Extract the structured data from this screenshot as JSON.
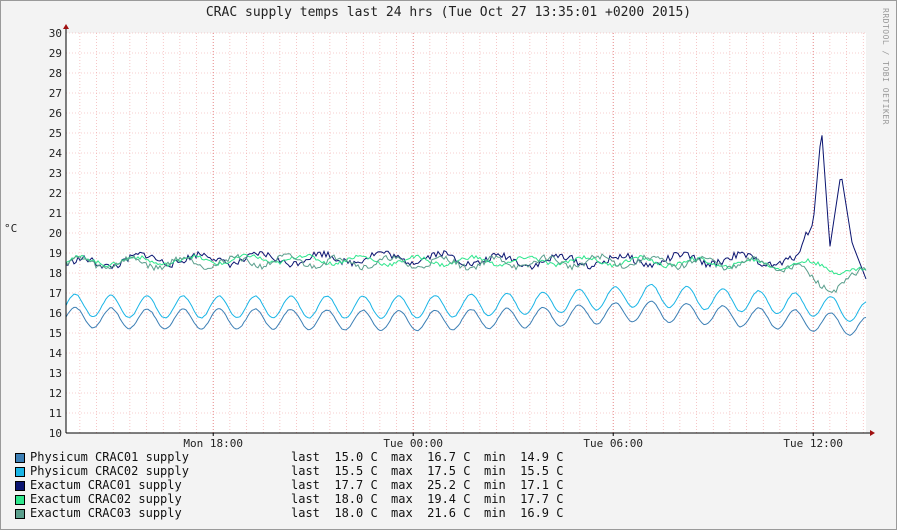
{
  "watermark": "RRDTOOL / TOBI OETIKER",
  "chart_data": {
    "type": "line",
    "title": "CRAC supply temps last 24 hrs (Tue Oct 27 13:35:01 +0200 2015)",
    "ylabel": "°C",
    "xlabel": "",
    "ylim": [
      10,
      30
    ],
    "yticks": [
      10,
      11,
      12,
      13,
      14,
      15,
      16,
      17,
      18,
      19,
      20,
      21,
      22,
      23,
      24,
      25,
      26,
      27,
      28,
      29,
      30
    ],
    "xlim": [
      "2015-10-26 13:35",
      "2015-10-27 13:35"
    ],
    "xticks": [
      {
        "label": "Mon 18:00",
        "time": "2015-10-26 18:00"
      },
      {
        "label": "Tue 00:00",
        "time": "2015-10-27 00:00"
      },
      {
        "label": "Tue 06:00",
        "time": "2015-10-27 06:00"
      },
      {
        "label": "Tue 12:00",
        "time": "2015-10-27 12:00"
      }
    ],
    "grid": true,
    "legend_position": "bottom",
    "series": [
      {
        "name": "Physicum CRAC01 supply",
        "color": "#3c7fb5",
        "last": "15.0 C",
        "max": "16.7 C",
        "min": "14.9 C",
        "points": [
          [
            "2015-10-26 13:35",
            15.8
          ],
          [
            "2015-10-26 16:00",
            15.7
          ],
          [
            "2015-10-26 20:00",
            15.7
          ],
          [
            "2015-10-27 00:00",
            15.6
          ],
          [
            "2015-10-27 04:00",
            15.8
          ],
          [
            "2015-10-27 07:00",
            16.1
          ],
          [
            "2015-10-27 10:00",
            15.8
          ],
          [
            "2015-10-27 12:00",
            15.6
          ],
          [
            "2015-10-27 13:35",
            15.3
          ]
        ]
      },
      {
        "name": "Physicum CRAC02 supply",
        "color": "#1ab5e6",
        "last": "15.5 C",
        "max": "17.5 C",
        "min": "15.5 C",
        "points": [
          [
            "2015-10-26 13:35",
            16.4
          ],
          [
            "2015-10-26 16:00",
            16.3
          ],
          [
            "2015-10-26 20:00",
            16.3
          ],
          [
            "2015-10-27 00:00",
            16.3
          ],
          [
            "2015-10-27 04:00",
            16.5
          ],
          [
            "2015-10-27 07:00",
            16.9
          ],
          [
            "2015-10-27 10:00",
            16.6
          ],
          [
            "2015-10-27 12:00",
            16.4
          ],
          [
            "2015-10-27 13:35",
            16.0
          ]
        ]
      },
      {
        "name": "Exactum CRAC01 supply",
        "color": "#0a1470",
        "last": "17.7 C",
        "max": "25.2 C",
        "min": "17.1 C",
        "points": [
          [
            "2015-10-26 13:35",
            18.4
          ],
          [
            "2015-10-26 16:00",
            18.7
          ],
          [
            "2015-10-26 20:00",
            18.7
          ],
          [
            "2015-10-27 00:00",
            18.8
          ],
          [
            "2015-10-27 03:00",
            18.6
          ],
          [
            "2015-10-27 06:00",
            18.6
          ],
          [
            "2015-10-27 09:00",
            18.7
          ],
          [
            "2015-10-27 11:30",
            18.6
          ],
          [
            "2015-10-27 12:00",
            20.5
          ],
          [
            "2015-10-27 12:15",
            25.2
          ],
          [
            "2015-10-27 12:30",
            19.3
          ],
          [
            "2015-10-27 12:50",
            23.0
          ],
          [
            "2015-10-27 13:10",
            19.5
          ],
          [
            "2015-10-27 13:35",
            17.7
          ]
        ]
      },
      {
        "name": "Exactum CRAC02 supply",
        "color": "#2ee68c",
        "last": "18.0 C",
        "max": "19.4 C",
        "min": "17.7 C",
        "points": [
          [
            "2015-10-26 13:35",
            18.6
          ],
          [
            "2015-10-26 16:00",
            18.6
          ],
          [
            "2015-10-26 20:00",
            18.7
          ],
          [
            "2015-10-27 00:00",
            18.6
          ],
          [
            "2015-10-27 03:00",
            18.6
          ],
          [
            "2015-10-27 06:00",
            18.6
          ],
          [
            "2015-10-27 09:00",
            18.5
          ],
          [
            "2015-10-27 12:00",
            18.4
          ],
          [
            "2015-10-27 13:35",
            18.0
          ]
        ]
      },
      {
        "name": "Exactum CRAC03 supply",
        "color": "#5a9e8c",
        "last": "18.0 C",
        "max": "21.6 C",
        "min": "16.9 C",
        "points": [
          [
            "2015-10-26 13:35",
            18.5
          ],
          [
            "2015-10-26 16:00",
            18.5
          ],
          [
            "2015-10-26 20:00",
            18.6
          ],
          [
            "2015-10-27 00:00",
            18.5
          ],
          [
            "2015-10-27 03:00",
            18.5
          ],
          [
            "2015-10-27 06:00",
            18.6
          ],
          [
            "2015-10-27 09:00",
            18.5
          ],
          [
            "2015-10-27 11:30",
            18.4
          ],
          [
            "2015-10-27 12:00",
            17.5
          ],
          [
            "2015-10-27 12:30",
            17.3
          ],
          [
            "2015-10-27 13:00",
            17.6
          ],
          [
            "2015-10-27 13:35",
            18.0
          ]
        ]
      }
    ]
  }
}
